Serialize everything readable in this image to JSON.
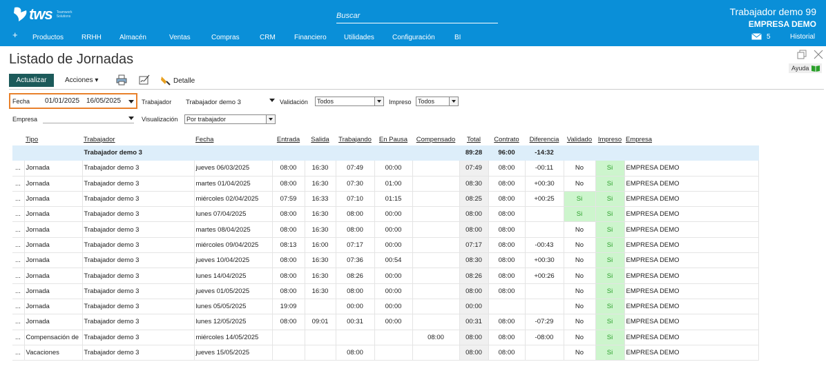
{
  "app": {
    "logo_text": "tws",
    "logo_sub": "Teamwork Solutions",
    "search_placeholder": "Buscar",
    "user_name": "Trabajador demo 99",
    "company": "EMPRESA DEMO",
    "mail_count": "5",
    "historial": "Historial"
  },
  "nav": [
    "+",
    "Productos",
    "RRHH",
    "Almacén",
    "Ventas",
    "Compras",
    "CRM",
    "Financiero",
    "Utilidades",
    "Configuración",
    "BI"
  ],
  "page": {
    "title": "Listado de Jornadas",
    "help": "Ayuda"
  },
  "toolbar": {
    "refresh": "Actualizar",
    "actions": "Acciones",
    "detail": "Detalle"
  },
  "filters": {
    "fecha_label": "Fecha",
    "date_from": "01/01/2025",
    "date_to": "16/05/2025",
    "trabajador_label": "Trabajador",
    "trabajador_value": "Trabajador demo 3",
    "validacion_label": "Validación",
    "validacion_value": "Todos",
    "impreso_label": "Impreso",
    "impreso_value": "Todos",
    "empresa_label": "Empresa",
    "empresa_value": "",
    "visualizacion_label": "Visualización",
    "visualizacion_value": "Por trabajador"
  },
  "table": {
    "headers": [
      "",
      "Tipo",
      "Trabajador",
      "Fecha",
      "Entrada",
      "Salida",
      "Trabajando",
      "En Pausa",
      "Compensado",
      "Total",
      "Contrato",
      "Diferencia",
      "Validado",
      "Impreso",
      "Empresa"
    ],
    "summary": {
      "trabajador": "Trabajador demo 3",
      "total": "89:28",
      "contrato": "96:00",
      "diferencia": "-14:32"
    },
    "rows": [
      [
        "...",
        "Jornada",
        "Trabajador demo 3",
        "jueves 06/03/2025",
        "08:00",
        "16:30",
        "07:49",
        "00:00",
        "",
        "07:49",
        "08:00",
        "-00:11",
        "No",
        "Si",
        "EMPRESA DEMO"
      ],
      [
        "...",
        "Jornada",
        "Trabajador demo 3",
        "martes 01/04/2025",
        "08:00",
        "16:30",
        "07:30",
        "01:00",
        "",
        "08:30",
        "08:00",
        "+00:30",
        "No",
        "Si",
        "EMPRESA DEMO"
      ],
      [
        "...",
        "Jornada",
        "Trabajador demo 3",
        "miércoles 02/04/2025",
        "07:59",
        "16:33",
        "07:10",
        "01:15",
        "",
        "08:25",
        "08:00",
        "+00:25",
        "Si",
        "Si",
        "EMPRESA DEMO"
      ],
      [
        "...",
        "Jornada",
        "Trabajador demo 3",
        "lunes 07/04/2025",
        "08:00",
        "16:30",
        "08:00",
        "00:00",
        "",
        "08:00",
        "08:00",
        "",
        "Si",
        "Si",
        "EMPRESA DEMO"
      ],
      [
        "...",
        "Jornada",
        "Trabajador demo 3",
        "martes 08/04/2025",
        "08:00",
        "16:30",
        "08:00",
        "00:00",
        "",
        "08:00",
        "08:00",
        "",
        "No",
        "Si",
        "EMPRESA DEMO"
      ],
      [
        "...",
        "Jornada",
        "Trabajador demo 3",
        "miércoles 09/04/2025",
        "08:13",
        "16:00",
        "07:17",
        "00:00",
        "",
        "07:17",
        "08:00",
        "-00:43",
        "No",
        "Si",
        "EMPRESA DEMO"
      ],
      [
        "...",
        "Jornada",
        "Trabajador demo 3",
        "jueves 10/04/2025",
        "08:00",
        "16:30",
        "07:36",
        "00:54",
        "",
        "08:30",
        "08:00",
        "+00:30",
        "No",
        "Si",
        "EMPRESA DEMO"
      ],
      [
        "...",
        "Jornada",
        "Trabajador demo 3",
        "lunes 14/04/2025",
        "08:00",
        "16:30",
        "08:26",
        "00:00",
        "",
        "08:26",
        "08:00",
        "+00:26",
        "No",
        "Si",
        "EMPRESA DEMO"
      ],
      [
        "...",
        "Jornada",
        "Trabajador demo 3",
        "jueves 01/05/2025",
        "08:00",
        "16:30",
        "08:00",
        "00:00",
        "",
        "08:00",
        "08:00",
        "",
        "No",
        "Si",
        "EMPRESA DEMO"
      ],
      [
        "...",
        "Jornada",
        "Trabajador demo 3",
        "lunes 05/05/2025",
        "19:09",
        "",
        "00:00",
        "00:00",
        "",
        "00:00",
        "",
        "",
        "No",
        "Si",
        "EMPRESA DEMO"
      ],
      [
        "...",
        "Jornada",
        "Trabajador demo 3",
        "lunes 12/05/2025",
        "08:00",
        "09:01",
        "00:31",
        "00:00",
        "",
        "00:31",
        "08:00",
        "-07:29",
        "No",
        "Si",
        "EMPRESA DEMO"
      ],
      [
        "...",
        "Compensación de",
        "Trabajador demo 3",
        "miércoles 14/05/2025",
        "",
        "",
        "",
        "",
        "08:00",
        "08:00",
        "08:00",
        "-08:00",
        "No",
        "Si",
        "EMPRESA DEMO"
      ],
      [
        "...",
        "Vacaciones",
        "Trabajador demo 3",
        "jueves 15/05/2025",
        "",
        "",
        "08:00",
        "",
        "",
        "08:00",
        "08:00",
        "",
        "No",
        "Si",
        "EMPRESA DEMO"
      ]
    ]
  },
  "colors": {
    "topbar": "#0a8fd8",
    "refresh_button": "#1c5a5a",
    "highlight_border": "#e8802a",
    "green_cell": "#cdf5cd"
  }
}
